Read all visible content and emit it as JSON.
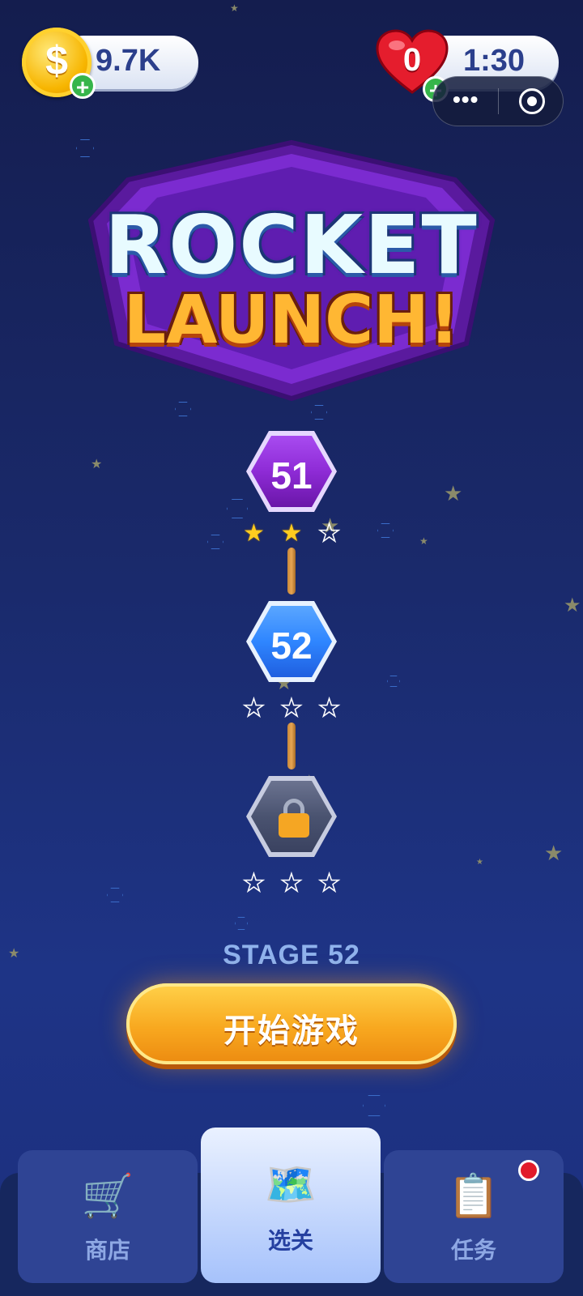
{
  "hud": {
    "coins": "9.7K",
    "coin_symbol": "$",
    "coin_plus": "+",
    "lives": "0",
    "life_timer": "1:30",
    "life_plus": "+",
    "capsule_more": "•••"
  },
  "logo": {
    "line1": "ROCKET",
    "line2": "LAUNCH!"
  },
  "levels": [
    {
      "number": "51",
      "state": "completed",
      "stars": 2,
      "color": "#8e2bd6"
    },
    {
      "number": "52",
      "state": "current",
      "stars": 0,
      "color": "#2f86ff"
    },
    {
      "number": "",
      "state": "locked",
      "stars": 0,
      "color": "#4a5370"
    }
  ],
  "stage_label": "STAGE 52",
  "start_button": "开始游戏",
  "nav": {
    "tabs": [
      {
        "label": "商店",
        "icon": "cart-icon",
        "glyph": "🛒",
        "active": false
      },
      {
        "label": "选关",
        "icon": "map-icon",
        "glyph": "🗺️",
        "active": true
      },
      {
        "label": "任务",
        "icon": "clipboard-icon",
        "glyph": "📋",
        "active": false,
        "badge": true
      }
    ]
  },
  "colors": {
    "accent_gold": "#f8a81f",
    "coin_text": "#2b3f8c",
    "stage_text": "#8fb2ec"
  }
}
